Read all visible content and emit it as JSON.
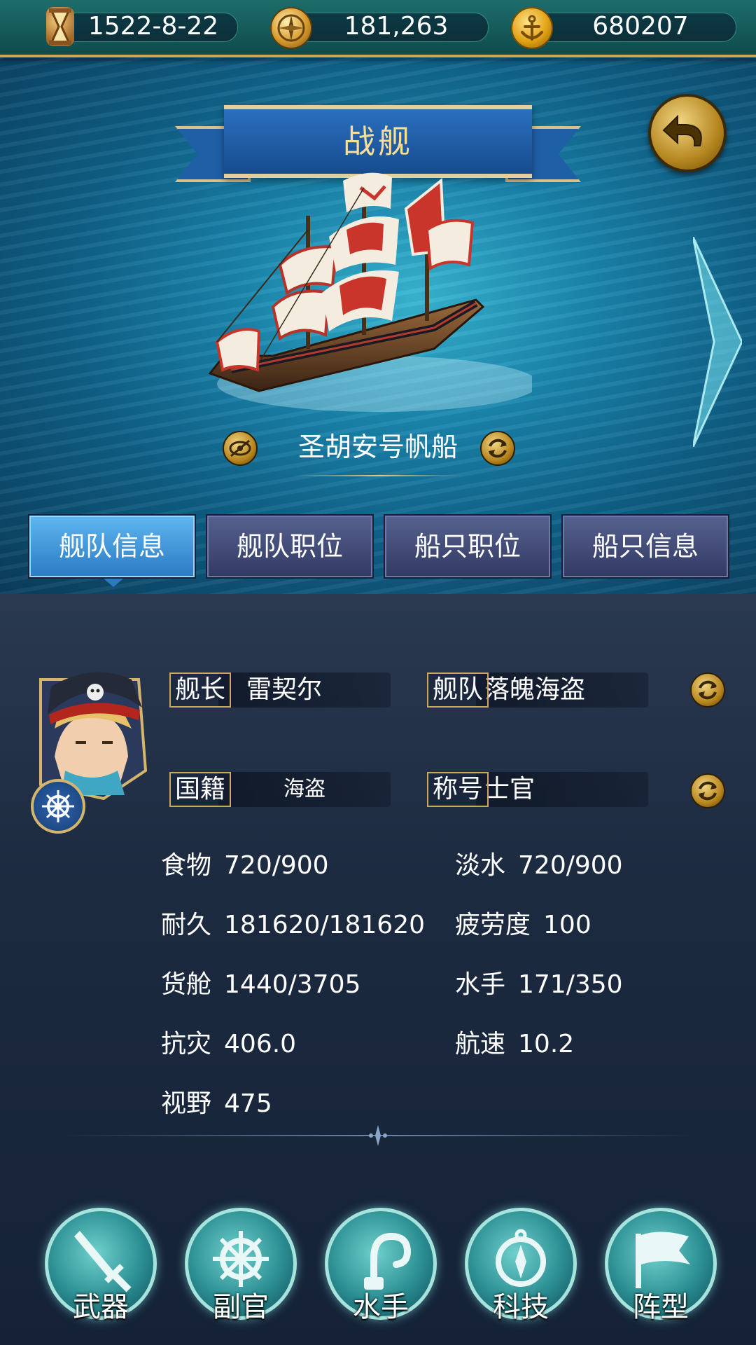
{
  "resources": {
    "date": "1522-8-22",
    "compass_value": "181,263",
    "gold_value": "680207",
    "icons": [
      "hourglass-icon",
      "compass-icon",
      "anchor-coin-icon"
    ]
  },
  "header": {
    "title": "战舰"
  },
  "ship": {
    "name": "圣胡安号帆船"
  },
  "tabs": [
    {
      "label": "舰队信息",
      "active": true
    },
    {
      "label": "舰队职位",
      "active": false
    },
    {
      "label": "船只职位",
      "active": false
    },
    {
      "label": "船只信息",
      "active": false
    }
  ],
  "captain": {
    "captain_label": "舰长",
    "captain_value": "雷契尔",
    "fleet_label": "舰队",
    "fleet_value": "落魄海盗",
    "nation_label": "国籍",
    "nation_value": "海盗",
    "title_label": "称号",
    "title_value": "士官"
  },
  "stats": [
    {
      "key": "食物",
      "value": "720/900"
    },
    {
      "key": "淡水",
      "value": "720/900"
    },
    {
      "key": "耐久",
      "value": "181620/181620"
    },
    {
      "key": "疲劳度",
      "value": "100"
    },
    {
      "key": "货舱",
      "value": "1440/3705"
    },
    {
      "key": "水手",
      "value": "171/350"
    },
    {
      "key": "抗灾",
      "value": "406.0"
    },
    {
      "key": "航速",
      "value": "10.2"
    },
    {
      "key": "视野",
      "value": "475"
    }
  ],
  "actions": [
    {
      "label": "武器",
      "icon": "sword-icon"
    },
    {
      "label": "副官",
      "icon": "ship-wheel-icon"
    },
    {
      "label": "水手",
      "icon": "hook-icon"
    },
    {
      "label": "科技",
      "icon": "compass-icon"
    },
    {
      "label": "阵型",
      "icon": "flag-icon"
    }
  ],
  "colors": {
    "gold": "#c9a95c",
    "tab_active": "#3a8fd6",
    "panel_bg": "#1c2a40"
  }
}
